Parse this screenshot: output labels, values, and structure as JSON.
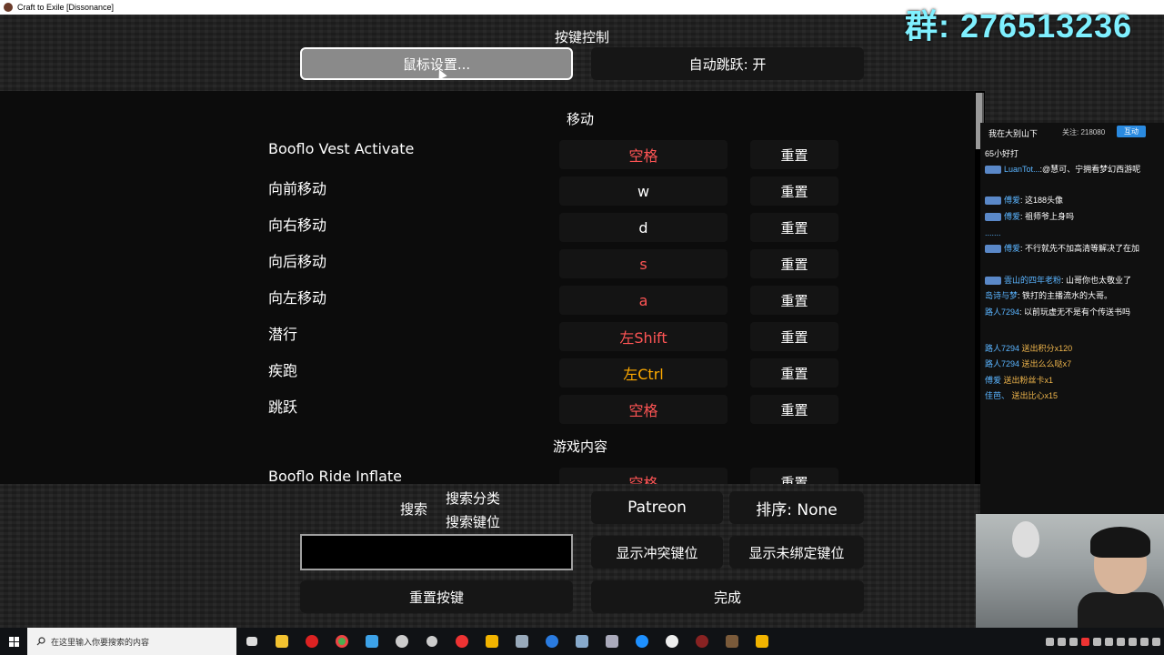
{
  "window": {
    "title": "Craft to Exile [Dissonance]"
  },
  "screen": {
    "title": "按键控制",
    "mouse_settings_label": "鼠标设置...",
    "auto_jump_label": "自动跳跃: 开"
  },
  "categories": {
    "movement": "移动",
    "gameplay": "游戏内容"
  },
  "reset_label": "重置",
  "bindings": [
    {
      "label": "Booflo Vest Activate",
      "key": "空格",
      "key_color": "#ff5555"
    },
    {
      "label": "向前移动",
      "key": "w",
      "key_color": "#ffffff"
    },
    {
      "label": "向右移动",
      "key": "d",
      "key_color": "#ffffff"
    },
    {
      "label": "向后移动",
      "key": "s",
      "key_color": "#ff5555"
    },
    {
      "label": "向左移动",
      "key": "a",
      "key_color": "#ff5555"
    },
    {
      "label": "潜行",
      "key": "左Shift",
      "key_color": "#ff5555"
    },
    {
      "label": "疾跑",
      "key": "左Ctrl",
      "key_color": "#ffaa00"
    },
    {
      "label": "跳跃",
      "key": "空格",
      "key_color": "#ff5555"
    },
    {
      "label": "Booflo Ride Inflate",
      "key": "空格",
      "key_color": "#ff5555"
    }
  ],
  "controls": {
    "search_label": "搜索",
    "search_category": "搜索分类",
    "search_keybind": "搜索键位",
    "patreon": "Patreon",
    "sort": "排序: None",
    "show_conflicts": "显示冲突键位",
    "show_unbound": "显示未绑定键位",
    "reset_keys": "重置按键",
    "done": "完成"
  },
  "overlay": {
    "group_number": "群: 276513236"
  },
  "chat": {
    "streamer": "我在大别山下",
    "followers": "关注: 218080",
    "interact_button": "互动",
    "messages": [
      {
        "user": "",
        "text": "65小好打"
      },
      {
        "user": "LuanTot...",
        "text": ":@慧可、宁拥看梦幻西游呢"
      },
      {
        "user": "傅爱",
        "text": ": 这188头像"
      },
      {
        "user": "傅爱",
        "text": ": 祖师爷上身吗"
      },
      {
        "user": "",
        "text": "......."
      },
      {
        "user": "傅爱",
        "text": ": 不行就先不加高清等解决了在加"
      },
      {
        "user": "雲山的四年老粉",
        "text": ": 山哥你也太敬业了"
      },
      {
        "user": "岛诗与梦",
        "text": ": 铁打的主播流水的大哥。"
      },
      {
        "user": "路人7294",
        "text": ": 以前玩虚无不是有个传送书吗"
      }
    ],
    "gifts": [
      {
        "user": "路人7294",
        "text": "送出积分",
        "count": "x120"
      },
      {
        "user": "路人7294",
        "text": "送出么么哒",
        "count": "x7"
      },
      {
        "user": "傅爱",
        "text": "送出粉丝卡",
        "count": "x1"
      },
      {
        "user": "佳芭、",
        "text": "送出比心",
        "count": "x15"
      }
    ]
  },
  "taskbar": {
    "search_placeholder": "在这里输入你要搜索的内容"
  }
}
